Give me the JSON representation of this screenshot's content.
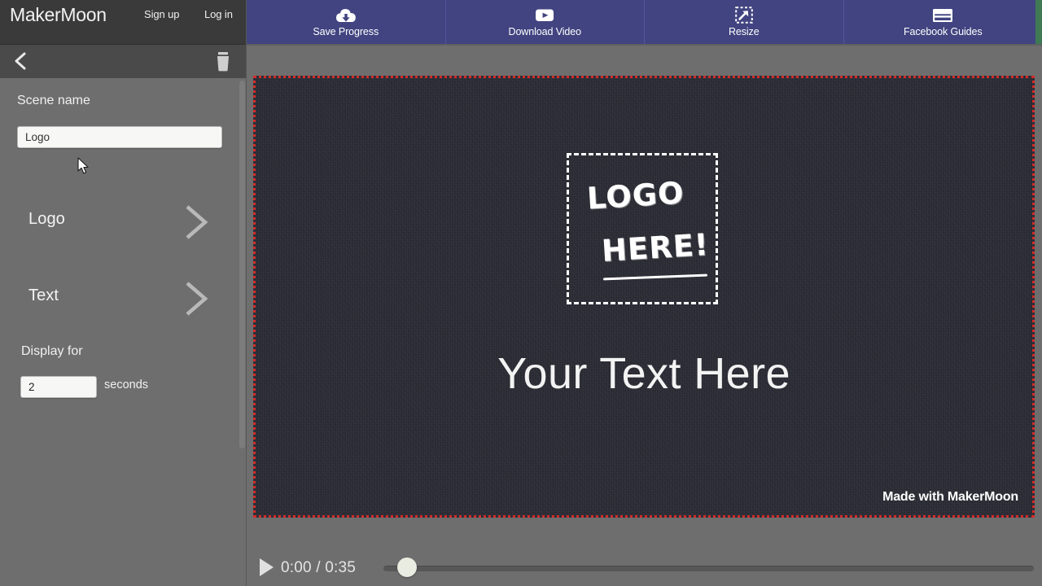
{
  "brand": {
    "title": "MakerMoon",
    "signup_label": "Sign up",
    "login_label": "Log in"
  },
  "scene_header": {
    "back_icon": "chevron-left-icon",
    "delete_icon": "trash-icon"
  },
  "sidebar": {
    "scene_name_label": "Scene name",
    "scene_name_value": "Logo",
    "scene_name_placeholder": "Scene name",
    "layers": [
      {
        "label": "Logo",
        "chevron": "chevron-right-icon"
      },
      {
        "label": "Text",
        "chevron": "chevron-right-icon"
      }
    ],
    "display_for_label": "Display for",
    "duration_value": "2",
    "duration_unit": "seconds"
  },
  "toolbar": {
    "buttons": [
      {
        "label": "Save Progress",
        "icon": "cloud-download-icon"
      },
      {
        "label": "Download Video",
        "icon": "youtube-play-icon"
      },
      {
        "label": "Resize",
        "icon": "resize-arrow-icon"
      },
      {
        "label": "Facebook Guides",
        "icon": "guides-rectangle-icon"
      }
    ],
    "background_color": "#414480",
    "right_accent_color": "#3f7a55"
  },
  "canvas": {
    "logo_placeholder": {
      "line1": "LOGO",
      "line2": "HERE!"
    },
    "main_text": "Your Text Here",
    "watermark": "Made with MakerMoon",
    "background_color": "#2b2b35",
    "selection_border_color": "#d42b28"
  },
  "player": {
    "play_icon": "play-triangle-icon",
    "current_time": "0:00",
    "separator": "/",
    "total_time": "0:35",
    "time_display": "0:00 / 0:35",
    "progress_percent": 2
  }
}
